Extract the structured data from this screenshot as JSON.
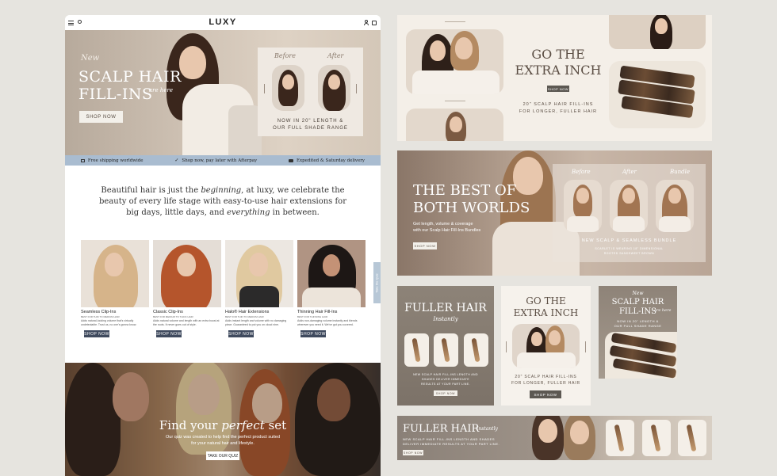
{
  "site": {
    "logo": "LUXY",
    "hero": {
      "kicker": "New",
      "title_line1": "SCALP HAIR",
      "title_line2": "FILL-INS",
      "side_script": "are here",
      "cta": "SHOP NOW",
      "before": "Before",
      "after": "After",
      "caption_line1": "NOW IN 20\" LENGTH &",
      "caption_line2": "OUR FULL SHADE RANGE"
    },
    "benefits": [
      {
        "icon": "gift-icon",
        "label": "Free shipping worldwide"
      },
      {
        "icon": "check-icon",
        "label": "Shop now, pay later with Afterpay"
      },
      {
        "icon": "truck-icon",
        "label": "Expedited & Saturday delivery"
      }
    ],
    "intro": {
      "p1": "Beautiful hair is just the ",
      "em1": "beginning",
      "p2": ", at luxy, we celebrate the beauty of every life stage with easy-to-use hair extensions for big days, little days, and ",
      "em2": "everything",
      "p3": " in between."
    },
    "side_tab": "Take the Quiz",
    "products": [
      {
        "name": "Seamless Clip-Ins",
        "sub": "BEST FOR THIN TO MEDIUM HAIR",
        "desc": "Adds natural-looking volume that's virtually undetectable. Trust us, no one's gonna know.",
        "cta": "SHOP NOW"
      },
      {
        "name": "Classic Clip-Ins",
        "sub": "BEST FOR MEDIUM TO THICK HAIR",
        "desc": "Adds natural volume and length with an extra boost at the roots. It never goes out of style.",
        "cta": "SHOP NOW"
      },
      {
        "name": "Halo® Hair Extensions",
        "sub": "BEST FOR THIN TO MEDIUM HAIR",
        "desc": "Adds instant length and volume with no damaging piece. Guaranteed to put you on cloud nine.",
        "cta": "SHOP NOW"
      },
      {
        "name": "Thinning Hair Fill-Ins",
        "sub": "BEST FOR THINNING HAIR",
        "desc": "Adds non-damaging volume instantly and blends wherever you need it. We've got you covered.",
        "cta": "SHOP NOW"
      }
    ],
    "quiz": {
      "title_a": "Find your ",
      "title_b": "perfect",
      "title_c": " set",
      "desc_line1": "Our quiz was created to help find the perfect product suited",
      "desc_line2": "for your natural hair and lifestyle.",
      "cta": "TAKE OUR QUIZ"
    }
  },
  "ads": {
    "extra_inch": {
      "title_line1": "GO THE",
      "title_line2": "EXTRA INCH",
      "cta": "SHOP NOW",
      "caption_line1": "20\" SCALP HAIR FILL-INS",
      "caption_line2": "FOR LONGER, FULLER HAIR"
    },
    "best_of": {
      "title_line1": "THE BEST OF",
      "title_line2": "BOTH WORLDS",
      "desc_line1": "Get length, volume & coverage",
      "desc_line2": "with our Scalp Hair Fill-Ins Bundles",
      "cta": "SHOP NOW",
      "labels": [
        "Before",
        "After",
        "Bundle"
      ],
      "caption": "NEW SCALP & SEAMLESS BUNDLE",
      "fine_line1": "SCARLET IS WEARING 18\" DIMENSIONAL",
      "fine_line2": "ROOTED SANDSWEET BROWN"
    },
    "fuller_square": {
      "title": "FULLER HAIR",
      "script": "Instantly",
      "fine_line1": "NEW SCALP HAIR FILL-INS LENGTH AND",
      "fine_line2": "SHADES DELIVER IMMEDIATE",
      "fine_line3": "RESULTS AT YOUR PART LINE.",
      "cta": "SHOP NOW"
    },
    "extra_inch_square": {
      "title_line1": "GO THE",
      "title_line2": "EXTRA INCH",
      "caption_line1": "20\" SCALP HAIR FILL-INS",
      "caption_line2": "FOR LONGER, FULLER HAIR",
      "cta": "SHOP NOW"
    },
    "scalp_square": {
      "kicker": "New",
      "title_line1": "SCALP HAIR",
      "title_line2": "FILL-INS",
      "script": "are here",
      "caption_line1": "NOW IN 20\" LENGTH &",
      "caption_line2": "OUR FULL SHADE RANGE"
    },
    "fuller_banner": {
      "title": "FULLER HAIR",
      "script": "Instantly",
      "fine_line1": "NEW SCALP HAIR FILL-INS LENGTH AND SHADES",
      "fine_line2": "DELIVER IMMEDIATE RESULTS AT YOUR PART LINE.",
      "cta": "SHOP NOW"
    }
  },
  "colors": {
    "background": "#e6e4df",
    "accent_navy": "#3f4a5e",
    "benefit_bar": "#a9bcd0",
    "cream": "#f4efe8"
  }
}
